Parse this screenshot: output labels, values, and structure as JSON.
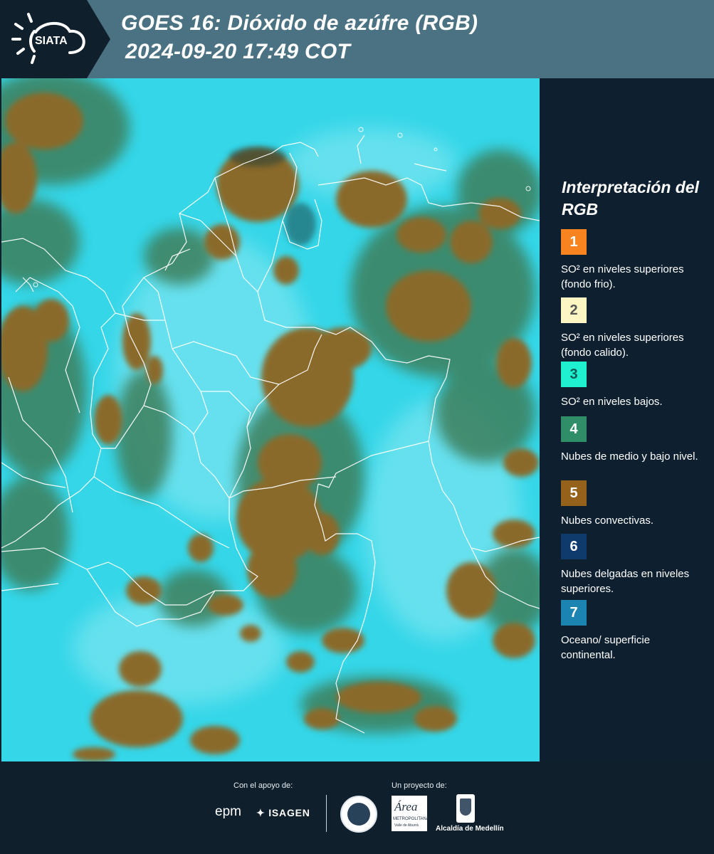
{
  "header": {
    "logo_text": "SIATA",
    "title_line1": "GOES 16: Dióxido de azúfre (RGB)",
    "title_line2": "2024-09-20 17:49 COT"
  },
  "legend": {
    "title": "Interpretación del RGB",
    "items": [
      {
        "number": "1",
        "color": "#f7841e",
        "number_color": "#ffffff",
        "text": "SO² en niveles superiores (fondo frio)."
      },
      {
        "number": "2",
        "color": "#fdf6c4",
        "number_color": "#555555",
        "text": "SO² en niveles superiores (fondo calido)."
      },
      {
        "number": "3",
        "color": "#1ff0cf",
        "number_color": "#0e5a55",
        "text": "SO² en niveles bajos."
      },
      {
        "number": "4",
        "color": "#2f8d67",
        "number_color": "#ffffff",
        "text": "Nubes de medio y bajo nivel."
      },
      {
        "number": "5",
        "color": "#94621b",
        "number_color": "#ffffff",
        "text": "Nubes convectivas."
      },
      {
        "number": "6",
        "color": "#0e3a6c",
        "number_color": "#ffffff",
        "text": "Nubes delgadas en niveles superiores."
      },
      {
        "number": "7",
        "color": "#1b84b1",
        "number_color": "#ffffff",
        "text": "Oceano/ superficie continental."
      }
    ]
  },
  "footer": {
    "support_label": "Con el apoyo de:",
    "project_label": "Un proyecto de:",
    "epm_logo_text": "epm",
    "isagen_logo_text": "ISAGEN",
    "area_logo_text": "Área",
    "area_logo_sub": "METROPOLITANA",
    "area_logo_sub2": "Valle de Aburrá",
    "alcaldia_logo_text": "Alcaldía de Medellín"
  },
  "colors": {
    "header_bg": "#4b7282",
    "logo_panel_bg": "#0f1f2c",
    "panel_bg": "#0e2030",
    "map_cyan": "#34d6e8",
    "map_brown": "#8a6a2c",
    "map_green": "#3e7f5c",
    "border_white": "#ffffff"
  }
}
